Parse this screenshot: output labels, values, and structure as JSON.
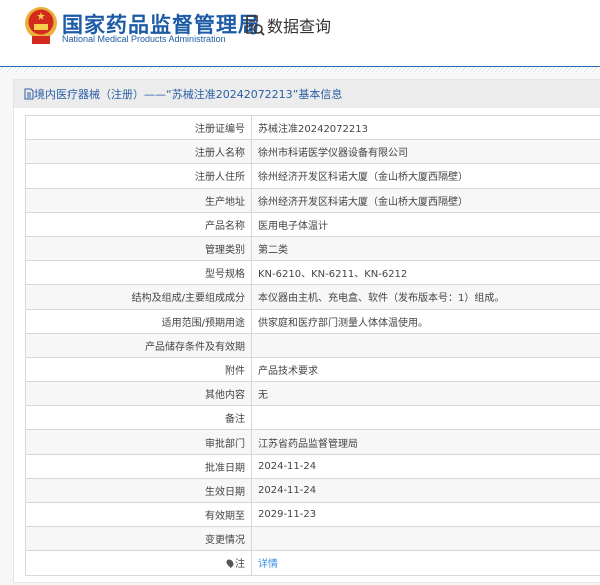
{
  "header": {
    "agency_cn": "国家药品监督管理局",
    "agency_en": "National Medical Products Administration",
    "section": "数据查询"
  },
  "panel": {
    "title": "境内医疗器械（注册）——“苏械注准20242072213”基本信息"
  },
  "rows": [
    {
      "label": "注册证编号",
      "value": "苏械注准20242072213"
    },
    {
      "label": "注册人名称",
      "value": "徐州市科诺医学仪器设备有限公司"
    },
    {
      "label": "注册人住所",
      "value": "徐州经济开发区科诺大厦（金山桥大厦西隔壁）"
    },
    {
      "label": "生产地址",
      "value": "徐州经济开发区科诺大厦（金山桥大厦西隔壁）"
    },
    {
      "label": "产品名称",
      "value": "医用电子体温计"
    },
    {
      "label": "管理类别",
      "value": "第二类"
    },
    {
      "label": "型号规格",
      "value": "KN-6210、KN-6211、KN-6212"
    },
    {
      "label": "结构及组成/主要组成成分",
      "value": "本仪器由主机、充电盒、软件（发布版本号：1）组成。"
    },
    {
      "label": "适用范围/预期用途",
      "value": "供家庭和医疗部门测量人体体温使用。"
    },
    {
      "label": "产品储存条件及有效期",
      "value": ""
    },
    {
      "label": "附件",
      "value": "产品技术要求"
    },
    {
      "label": "其他内容",
      "value": "无"
    },
    {
      "label": "备注",
      "value": ""
    },
    {
      "label": "审批部门",
      "value": "江苏省药品监督管理局"
    },
    {
      "label": "批准日期",
      "value": "2024-11-24"
    },
    {
      "label": "生效日期",
      "value": "2024-11-24"
    },
    {
      "label": "有效期至",
      "value": "2029-11-23"
    },
    {
      "label": "变更情况",
      "value": ""
    }
  ],
  "note": {
    "label": "注",
    "link": "详情"
  }
}
